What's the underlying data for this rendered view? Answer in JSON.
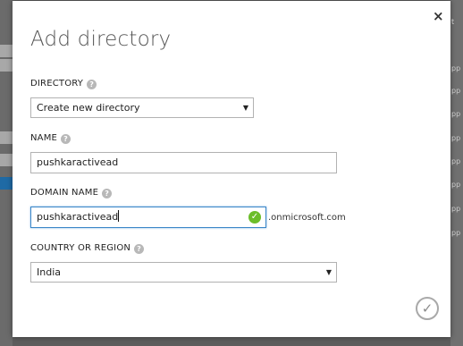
{
  "dialog": {
    "title": "Add directory",
    "close_icon": "×",
    "directory": {
      "label": "DIRECTORY",
      "selected": "Create new directory"
    },
    "name": {
      "label": "NAME",
      "value": "pushkaractivead"
    },
    "domain_name": {
      "label": "DOMAIN NAME",
      "value": "pushkaractivead",
      "suffix": ".onmicrosoft.com",
      "valid_icon": "check-circle-icon"
    },
    "country": {
      "label": "COUNTRY OR REGION",
      "selected": "India"
    },
    "help_glyph": "?",
    "dropdown_glyph": "▼",
    "valid_glyph": "✓",
    "confirm_glyph": "✓"
  },
  "background": {
    "right_fragments": [
      "t",
      "pp",
      "pp",
      "pp",
      "pp",
      "pp",
      "pp",
      "pp",
      "pp"
    ]
  },
  "colors": {
    "accent": "#3a86c8",
    "valid": "#6bbd2a",
    "overlay": "#5d5d5d"
  }
}
